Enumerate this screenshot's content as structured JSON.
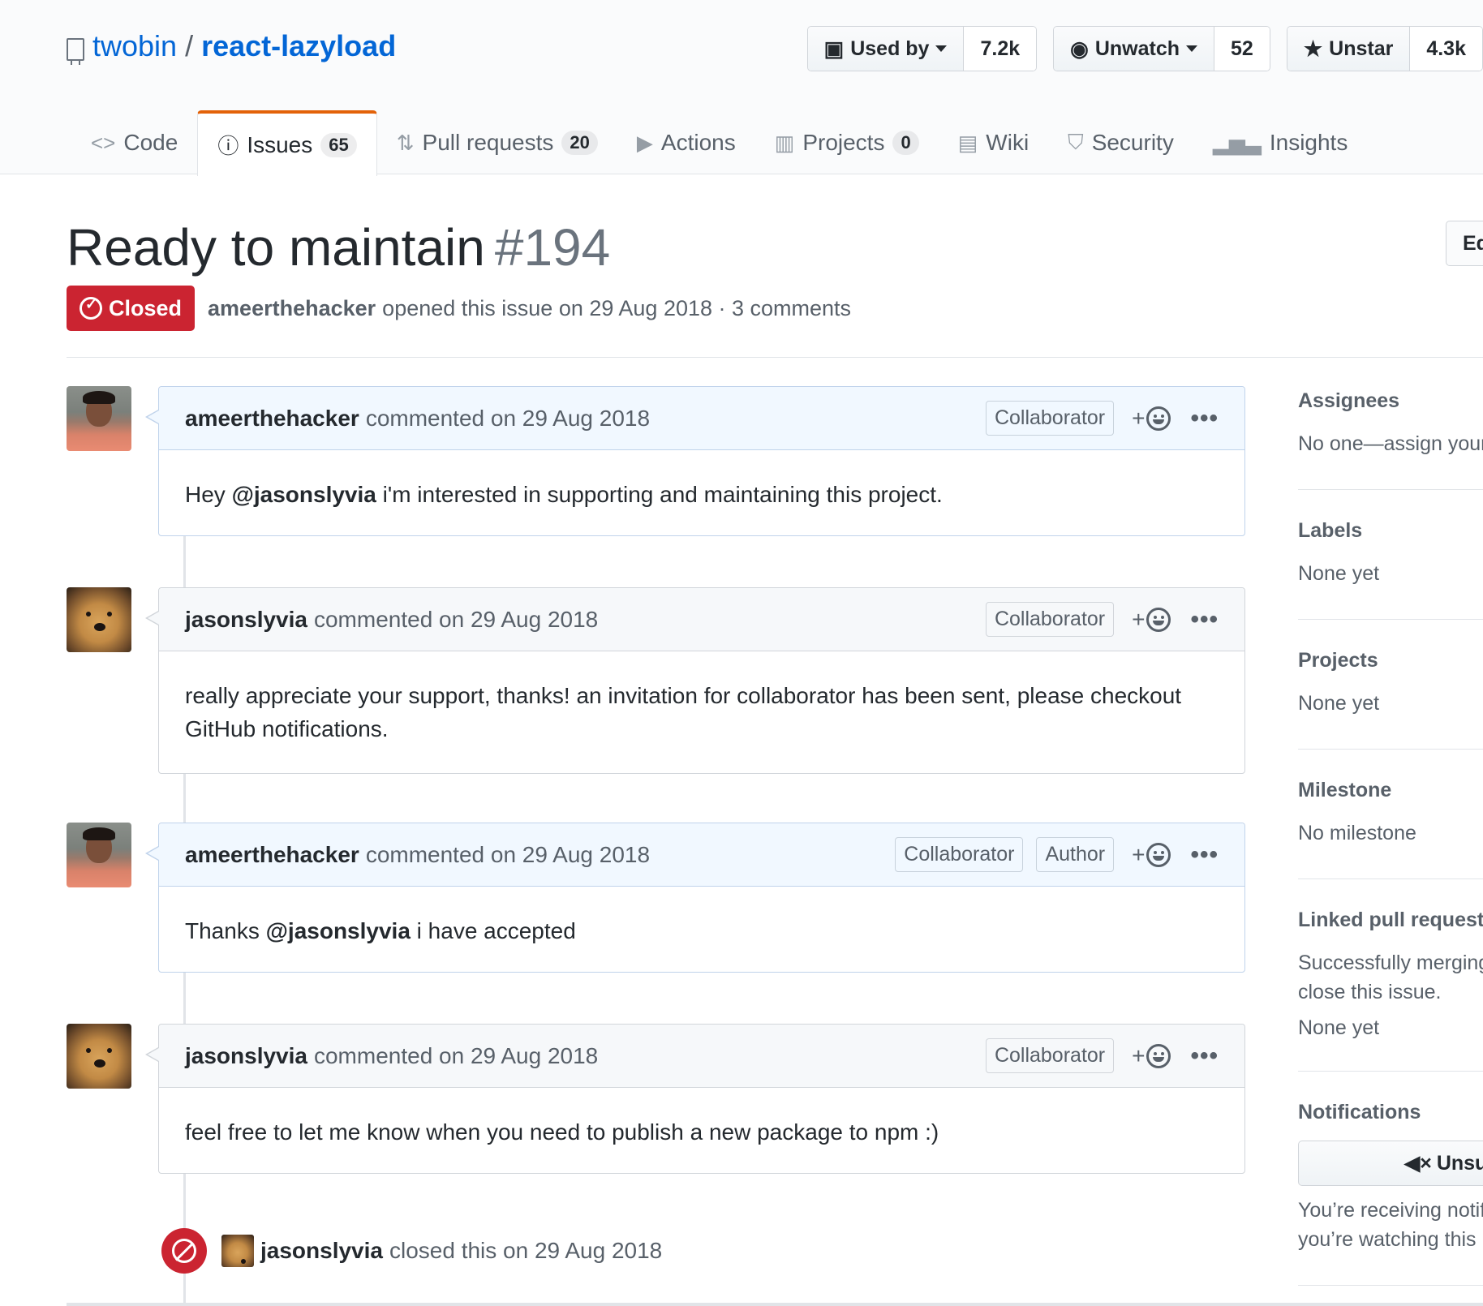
{
  "repo": {
    "owner": "twobin",
    "separator": "/",
    "name": "react-lazyload"
  },
  "actions": {
    "used_by": {
      "label": "Used by",
      "count": "7.2k"
    },
    "watch": {
      "label": "Unwatch",
      "count": "52"
    },
    "star": {
      "label": "Unstar",
      "count": "4.3k"
    }
  },
  "nav": {
    "code": "Code",
    "issues": {
      "label": "Issues",
      "count": "65"
    },
    "pulls": {
      "label": "Pull requests",
      "count": "20"
    },
    "actions": "Actions",
    "projects": {
      "label": "Projects",
      "count": "0"
    },
    "wiki": "Wiki",
    "security": "Security",
    "insights": "Insights"
  },
  "issue": {
    "title": "Ready to maintain",
    "number": "#194",
    "edit_label": "Ed",
    "state": "Closed",
    "author": "ameerthehacker",
    "meta": "opened this issue on 29 Aug 2018 · 3 comments"
  },
  "comments": [
    {
      "author": "ameerthehacker",
      "when": "commented on 29 Aug 2018",
      "labels": [
        "Collaborator"
      ],
      "body_prefix": "Hey ",
      "mention": "@jasonslyvia",
      "body_suffix": " i'm interested in supporting and maintaining this project."
    },
    {
      "author": "jasonslyvia",
      "when": "commented on 29 Aug 2018",
      "labels": [
        "Collaborator"
      ],
      "body": "really appreciate your support, thanks! an invitation for collaborator has been sent, please checkout GitHub notifications."
    },
    {
      "author": "ameerthehacker",
      "when": "commented on 29 Aug 2018",
      "labels": [
        "Collaborator",
        "Author"
      ],
      "body_prefix": "Thanks ",
      "mention": "@jasonslyvia",
      "body_suffix": " i have accepted"
    },
    {
      "author": "jasonslyvia",
      "when": "commented on 29 Aug 2018",
      "labels": [
        "Collaborator"
      ],
      "body": "feel free to let me know when you need to publish a new package to npm :)"
    }
  ],
  "reaction_plus": "+",
  "more_label": "•••",
  "event": {
    "actor": "jasonslyvia",
    "text": "closed this on 29 Aug 2018"
  },
  "sidebar": {
    "assignees": {
      "heading": "Assignees",
      "text": "No one—assign yours"
    },
    "labels": {
      "heading": "Labels",
      "text": "None yet"
    },
    "projects": {
      "heading": "Projects",
      "text": "None yet"
    },
    "milestone": {
      "heading": "Milestone",
      "text": "No milestone"
    },
    "linked_prs": {
      "heading": "Linked pull requests",
      "text_line1": "Successfully merging",
      "text_line2": "close this issue.",
      "sub": "None yet"
    },
    "notifications": {
      "heading": "Notifications",
      "button": "Unsu",
      "text_line1": "You’re receiving notif",
      "text_line2": "you’re watching this r"
    }
  },
  "colors": {
    "link": "#0366d6",
    "closed": "#cb2431",
    "tab_accent": "#e36209",
    "owner_comment_bg": "#f1f8ff"
  }
}
